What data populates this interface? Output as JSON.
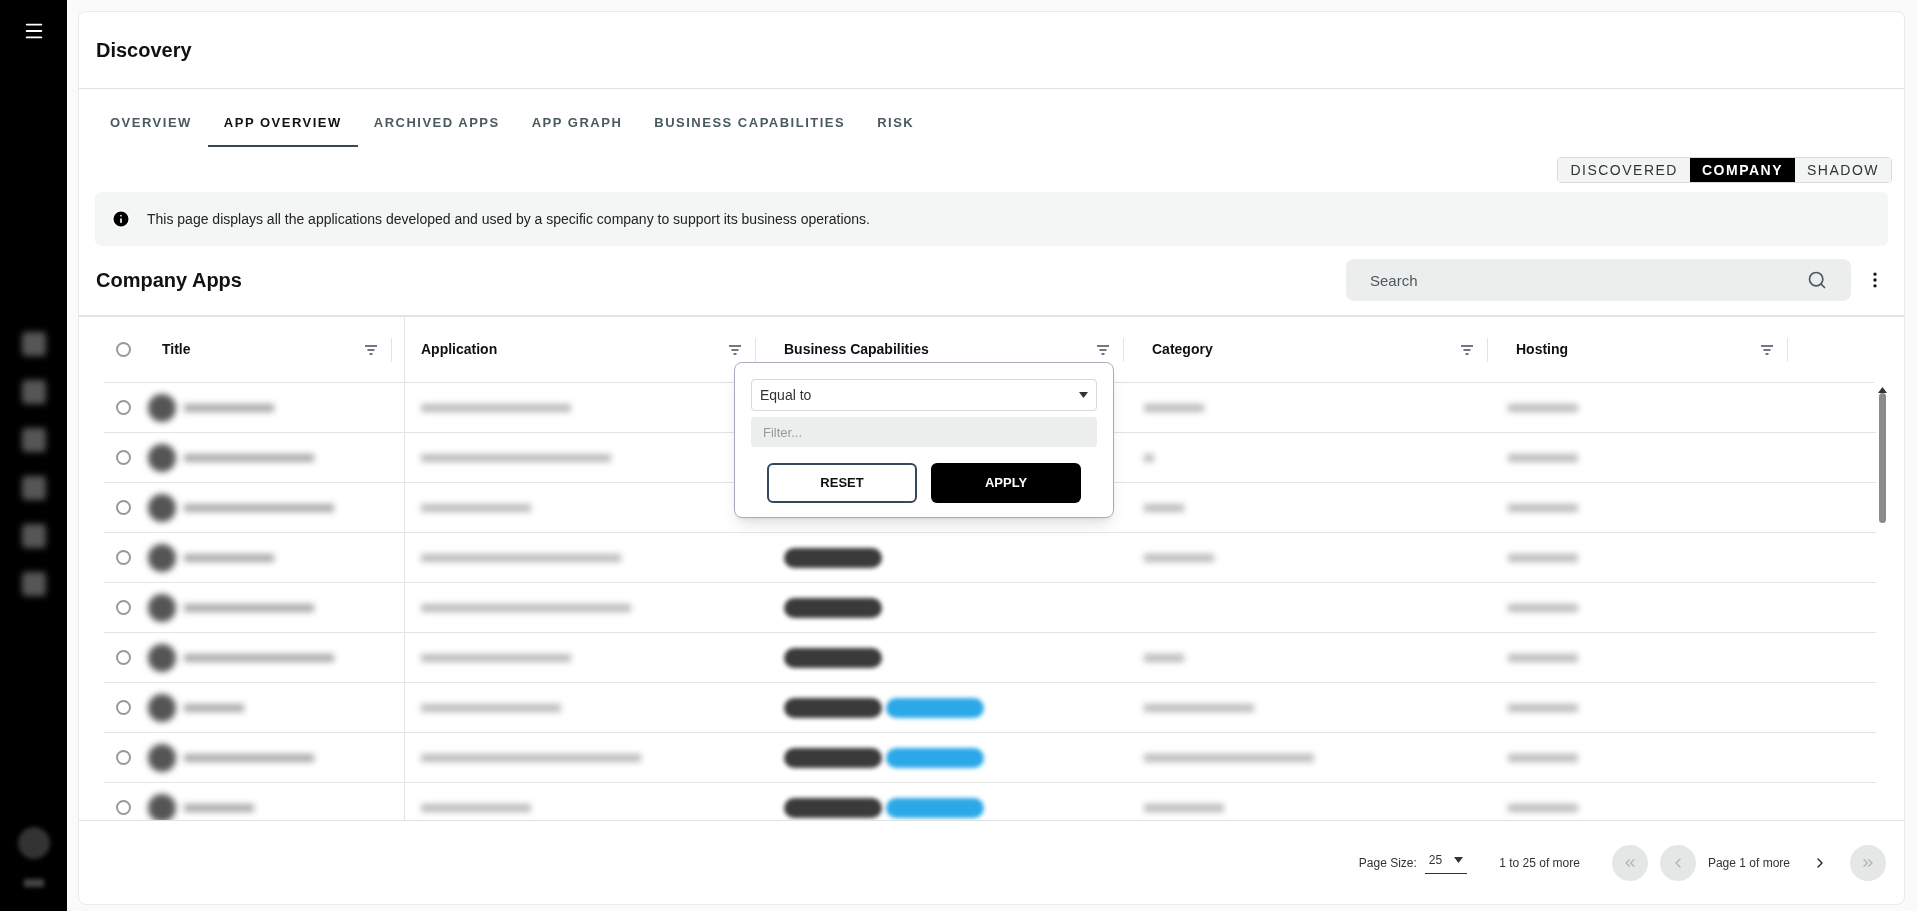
{
  "page": {
    "title": "Discovery"
  },
  "tabs": [
    {
      "label": "OVERVIEW",
      "selected": false
    },
    {
      "label": "APP OVERVIEW",
      "selected": true
    },
    {
      "label": "ARCHIVED APPS",
      "selected": false
    },
    {
      "label": "APP GRAPH",
      "selected": false
    },
    {
      "label": "BUSINESS CAPABILITIES",
      "selected": false
    },
    {
      "label": "RISK",
      "selected": false
    }
  ],
  "view_toggle": [
    {
      "label": "DISCOVERED",
      "selected": false
    },
    {
      "label": "COMPANY",
      "selected": true
    },
    {
      "label": "SHADOW",
      "selected": false
    }
  ],
  "info": "This page displays all the applications developed and used by a specific company to support its business operations.",
  "section": {
    "title": "Company Apps",
    "search": {
      "placeholder": "Search"
    }
  },
  "table": {
    "all_selected": false,
    "columns": [
      {
        "label": "Title"
      },
      {
        "label": "Application"
      },
      {
        "label": "Business Capabilities"
      },
      {
        "label": "Category"
      },
      {
        "label": "Hosting"
      }
    ],
    "rows": [
      {
        "selected": false
      },
      {
        "selected": false
      },
      {
        "selected": false
      },
      {
        "selected": false,
        "tags": [
          {
            "color": "#3a3a3a"
          }
        ]
      },
      {
        "selected": false,
        "tags": [
          {
            "color": "#3a3a3a"
          }
        ]
      },
      {
        "selected": false,
        "tags": [
          {
            "color": "#3a3a3a"
          }
        ]
      },
      {
        "selected": false,
        "tags": [
          {
            "color": "#3a3a3a"
          },
          {
            "color": "#2ba8e8"
          }
        ]
      },
      {
        "selected": false,
        "tags": [
          {
            "color": "#3a3a3a"
          },
          {
            "color": "#2ba8e8"
          }
        ]
      },
      {
        "selected": false,
        "tags": [
          {
            "color": "#3a3a3a"
          },
          {
            "color": "#2ba8e8"
          }
        ]
      }
    ]
  },
  "filter_popup": {
    "operator": "Equal to",
    "placeholder": "Filter...",
    "buttons": [
      {
        "label": "RESET",
        "kind": "secondary"
      },
      {
        "label": "APPLY",
        "kind": "primary"
      }
    ]
  },
  "pagination": {
    "page_size_label": "Page Size:",
    "page_size": "25",
    "range": "1 to 25 of more",
    "page": "Page 1 of more",
    "first_disabled": true,
    "prev_disabled": true,
    "next_disabled": false,
    "last_disabled": true
  }
}
